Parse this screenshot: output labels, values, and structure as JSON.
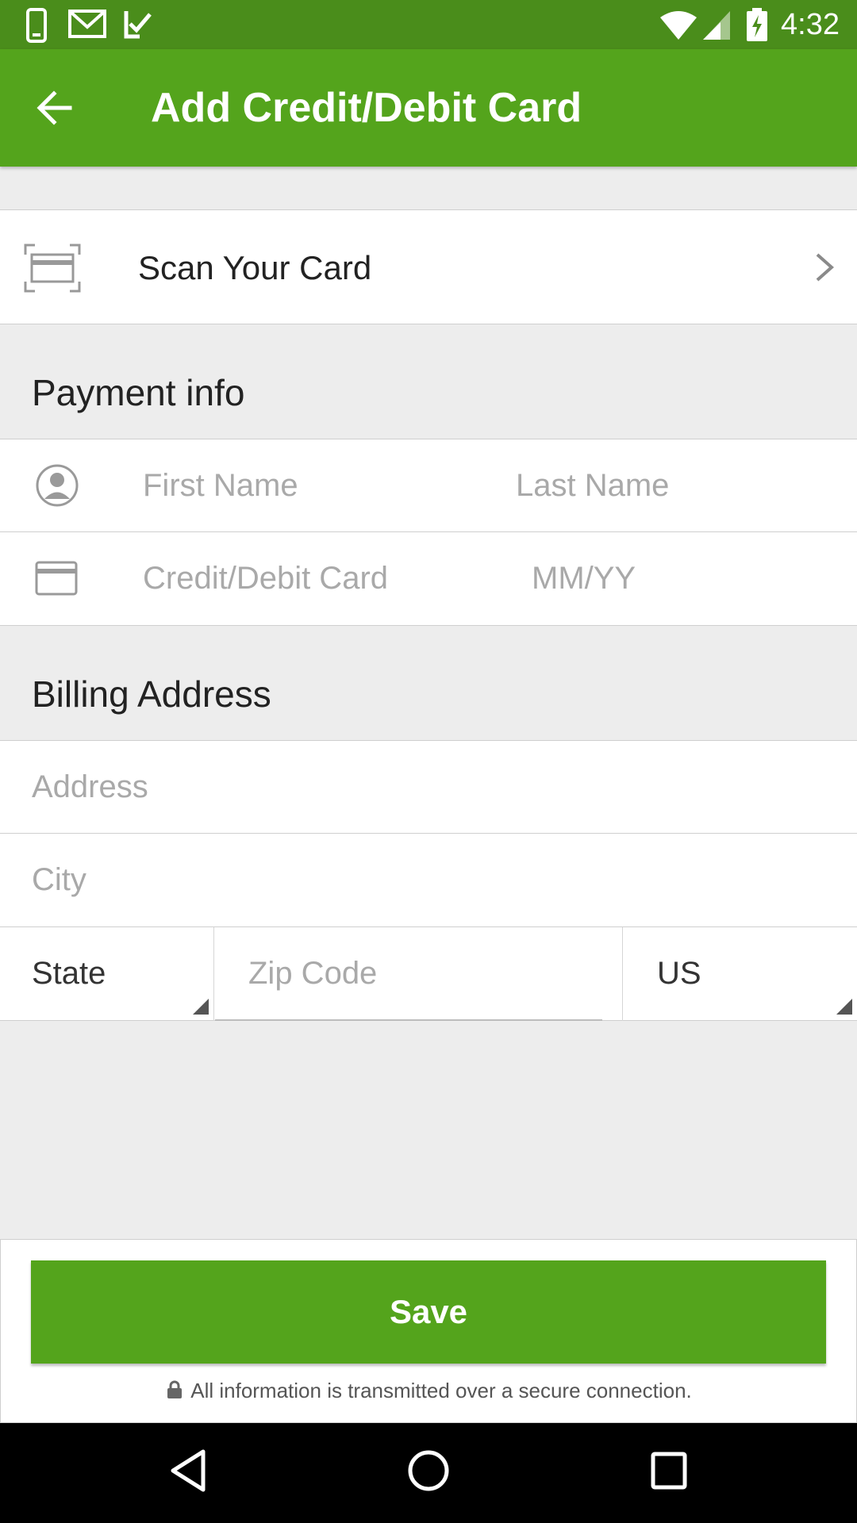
{
  "status_bar": {
    "time": "4:32",
    "icons_left": [
      "phone-icon",
      "gmail-icon",
      "tasks-check-icon"
    ],
    "icons_right": [
      "wifi-icon",
      "signal-icon",
      "battery-charging-icon"
    ]
  },
  "app_bar": {
    "title": "Add Credit/Debit Card",
    "back_icon": "arrow-back-icon"
  },
  "scan": {
    "label": "Scan Your Card",
    "icon": "card-scan-icon"
  },
  "payment": {
    "header": "Payment info",
    "first_name_placeholder": "First Name",
    "last_name_placeholder": "Last Name",
    "card_placeholder": "Credit/Debit Card",
    "expiry_placeholder": "MM/YY"
  },
  "billing": {
    "header": "Billing Address",
    "address_placeholder": "Address",
    "city_placeholder": "City",
    "state_value": "State",
    "zip_placeholder": "Zip Code",
    "country_value": "US"
  },
  "footer": {
    "save_label": "Save",
    "secure_note": "All information is transmitted over a secure connection."
  },
  "colors": {
    "status_bar": "#4a8d1b",
    "app_bar": "#54a41c",
    "save_button": "#54a41c",
    "background": "#ededed"
  }
}
